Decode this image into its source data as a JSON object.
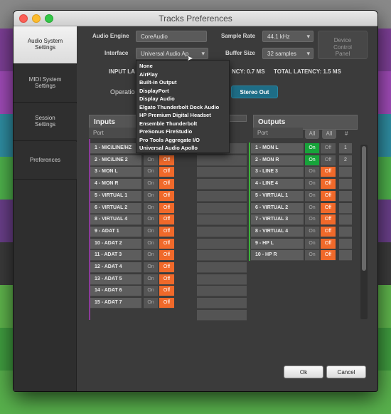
{
  "window": {
    "title": "Tracks Preferences"
  },
  "sidebar": {
    "items": [
      {
        "label": "Audio System Settings",
        "active": true
      },
      {
        "label": "MIDI System Settings",
        "active": false
      },
      {
        "label": "Session Settings",
        "active": false
      },
      {
        "label": "Preferences",
        "active": false
      }
    ]
  },
  "settings": {
    "audio_engine_label": "Audio Engine",
    "audio_engine_value": "CoreAudio",
    "interface_label": "Interface",
    "interface_value": "Universal Audio Ap",
    "sample_rate_label": "Sample Rate",
    "sample_rate_value": "44.1 kHz",
    "buffer_size_label": "Buffer Size",
    "buffer_size_value": "32 samples",
    "device_panel_label": "Device Control Panel",
    "input_latency_label": "INPUT LA",
    "output_latency_text": "NCY: 0.7 MS",
    "total_latency_text": "TOTAL LATENCY: 1.5 MS",
    "operation_label": "Operatio",
    "stereo_out_label": "Stereo Out"
  },
  "interface_menu": {
    "items": [
      "None",
      "AirPlay",
      "Built-in Output",
      "DisplayPort",
      "Display Audio",
      "Elgato Thunderbolt Dock Audio",
      "HP Premium Digital Headset",
      "Ensemble Thunderbolt",
      "PreSonus FireStudio",
      "Pro Tools Aggregate I/O",
      "Universal Audio Apollo"
    ]
  },
  "inputs": {
    "header": "Inputs",
    "port_col": "Port",
    "rows": [
      {
        "name": "1 - MIC/LINE/HZ",
        "on": "On",
        "off": "Off"
      },
      {
        "name": "2 - MIC/LINE 2",
        "on": "On",
        "off": "Off"
      },
      {
        "name": "3 - MON L",
        "on": "On",
        "off": "Off"
      },
      {
        "name": "4 - MON R",
        "on": "On",
        "off": "Off"
      },
      {
        "name": "5 - VIRTUAL 1",
        "on": "On",
        "off": "Off"
      },
      {
        "name": "6 - VIRTUAL 2",
        "on": "On",
        "off": "Off"
      },
      {
        "name": "8 - VIRTUAL 4",
        "on": "On",
        "off": "Off"
      },
      {
        "name": "9 - ADAT 1",
        "on": "On",
        "off": "Off"
      },
      {
        "name": "10 - ADAT 2",
        "on": "On",
        "off": "Off"
      },
      {
        "name": "11 - ADAT 3",
        "on": "On",
        "off": "Off"
      },
      {
        "name": "12 - ADAT 4",
        "on": "On",
        "off": "Off"
      },
      {
        "name": "13 - ADAT 5",
        "on": "On",
        "off": "Off"
      },
      {
        "name": "14 - ADAT 6",
        "on": "On",
        "off": "Off"
      },
      {
        "name": "15 - ADAT 7",
        "on": "On",
        "off": "Off"
      }
    ]
  },
  "outputs": {
    "header": "Outputs",
    "port_col": "Port",
    "all1": "All",
    "all2": "All",
    "num_col": "#",
    "rows": [
      {
        "name": "1 - MON L",
        "on": "On",
        "off": "Off",
        "state": "on",
        "num": "1"
      },
      {
        "name": "2 - MON R",
        "on": "On",
        "off": "Off",
        "state": "on",
        "num": "2"
      },
      {
        "name": "3 - LINE 3",
        "on": "On",
        "off": "Off",
        "state": "off",
        "num": ""
      },
      {
        "name": "4 - LINE 4",
        "on": "On",
        "off": "Off",
        "state": "off",
        "num": ""
      },
      {
        "name": "5 - VIRTUAL 1",
        "on": "On",
        "off": "Off",
        "state": "off",
        "num": ""
      },
      {
        "name": "6 - VIRTUAL 2",
        "on": "On",
        "off": "Off",
        "state": "off",
        "num": ""
      },
      {
        "name": "7 - VIRTUAL 3",
        "on": "On",
        "off": "Off",
        "state": "off",
        "num": ""
      },
      {
        "name": "8 - VIRTUAL 4",
        "on": "On",
        "off": "Off",
        "state": "off",
        "num": ""
      },
      {
        "name": "9 - HP L",
        "on": "On",
        "off": "Off",
        "state": "off",
        "num": ""
      },
      {
        "name": "10 - HP R",
        "on": "On",
        "off": "Off",
        "state": "off",
        "num": ""
      }
    ]
  },
  "footer": {
    "ok_label": "Ok",
    "cancel_label": "Cancel"
  },
  "colors": {
    "on_green": "#17a33a",
    "off_orange": "#f0692a",
    "stereo_blue": "#1e6d86"
  }
}
